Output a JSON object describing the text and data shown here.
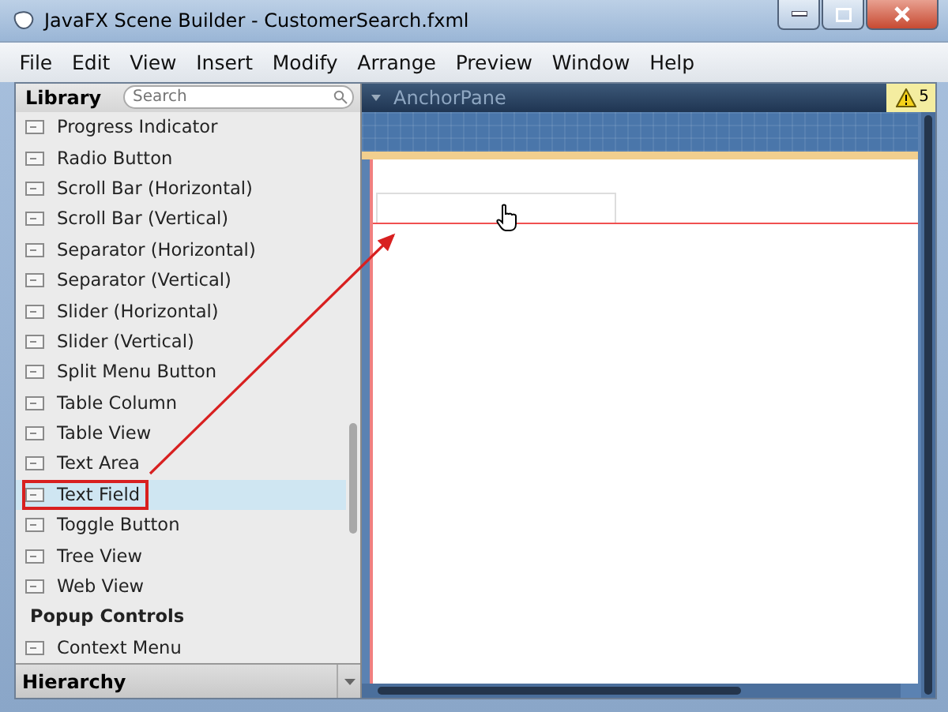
{
  "window": {
    "title": "JavaFX Scene Builder - CustomerSearch.fxml"
  },
  "menu": [
    "File",
    "Edit",
    "View",
    "Insert",
    "Modify",
    "Arrange",
    "Preview",
    "Window",
    "Help"
  ],
  "library": {
    "title": "Library",
    "search": {
      "placeholder": "Search"
    },
    "items": [
      {
        "kind": "item",
        "label": "Progress Indicator",
        "selected": false,
        "annotated": false
      },
      {
        "kind": "item",
        "label": "Radio Button",
        "selected": false,
        "annotated": false
      },
      {
        "kind": "item",
        "label": "Scroll Bar (Horizontal)",
        "selected": false,
        "annotated": false
      },
      {
        "kind": "item",
        "label": "Scroll Bar (Vertical)",
        "selected": false,
        "annotated": false
      },
      {
        "kind": "item",
        "label": "Separator (Horizontal)",
        "selected": false,
        "annotated": false
      },
      {
        "kind": "item",
        "label": "Separator (Vertical)",
        "selected": false,
        "annotated": false
      },
      {
        "kind": "item",
        "label": "Slider (Horizontal)",
        "selected": false,
        "annotated": false
      },
      {
        "kind": "item",
        "label": "Slider (Vertical)",
        "selected": false,
        "annotated": false
      },
      {
        "kind": "item",
        "label": "Split Menu Button",
        "selected": false,
        "annotated": false
      },
      {
        "kind": "item",
        "label": "Table Column",
        "selected": false,
        "annotated": false
      },
      {
        "kind": "item",
        "label": "Table View",
        "selected": false,
        "annotated": false
      },
      {
        "kind": "item",
        "label": "Text Area",
        "selected": false,
        "annotated": false
      },
      {
        "kind": "item",
        "label": "Text Field",
        "selected": true,
        "annotated": true
      },
      {
        "kind": "item",
        "label": "Toggle Button",
        "selected": false,
        "annotated": false
      },
      {
        "kind": "item",
        "label": "Tree View",
        "selected": false,
        "annotated": false
      },
      {
        "kind": "item",
        "label": "Web View",
        "selected": false,
        "annotated": false
      },
      {
        "kind": "header",
        "label": "Popup Controls",
        "selected": false,
        "annotated": false
      },
      {
        "kind": "item",
        "label": "Context Menu",
        "selected": false,
        "annotated": false
      }
    ]
  },
  "hierarchy": {
    "title": "Hierarchy"
  },
  "canvas": {
    "path": "AnchorPane",
    "warnings": "5"
  }
}
